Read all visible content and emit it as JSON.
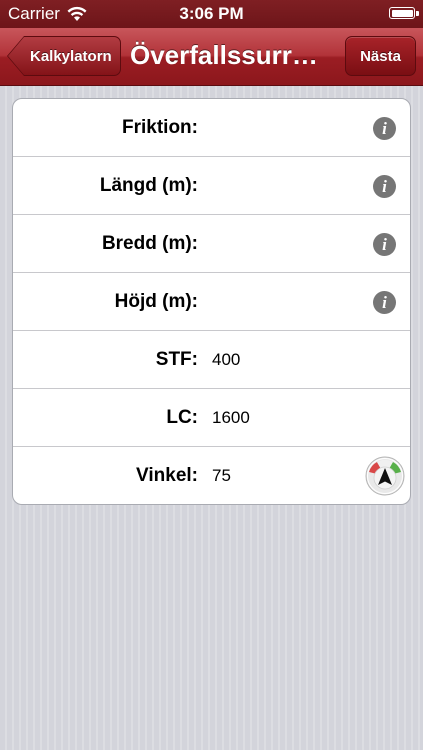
{
  "status_bar": {
    "carrier": "Carrier",
    "time": "3:06 PM"
  },
  "nav": {
    "back_label": "Kalkylatorn",
    "title": "Överfallssurr…",
    "next_label": "Nästa"
  },
  "form": {
    "rows": [
      {
        "label": "Friktion:",
        "value": "",
        "accessory": "info-icon"
      },
      {
        "label": "Längd (m):",
        "value": "",
        "accessory": "info-icon"
      },
      {
        "label": "Bredd (m):",
        "value": "",
        "accessory": "info-icon"
      },
      {
        "label": "Höjd (m):",
        "value": "",
        "accessory": "info-icon"
      },
      {
        "label": "STF:",
        "value": "400",
        "accessory": ""
      },
      {
        "label": "LC:",
        "value": "1600",
        "accessory": ""
      },
      {
        "label": "Vinkel:",
        "value": "75",
        "accessory": "angle-picker-icon"
      }
    ],
    "info_glyph": "i"
  },
  "colors": {
    "nav_red": "#a82329",
    "status_bar": "#7f1f23",
    "info_icon": "#767676"
  }
}
